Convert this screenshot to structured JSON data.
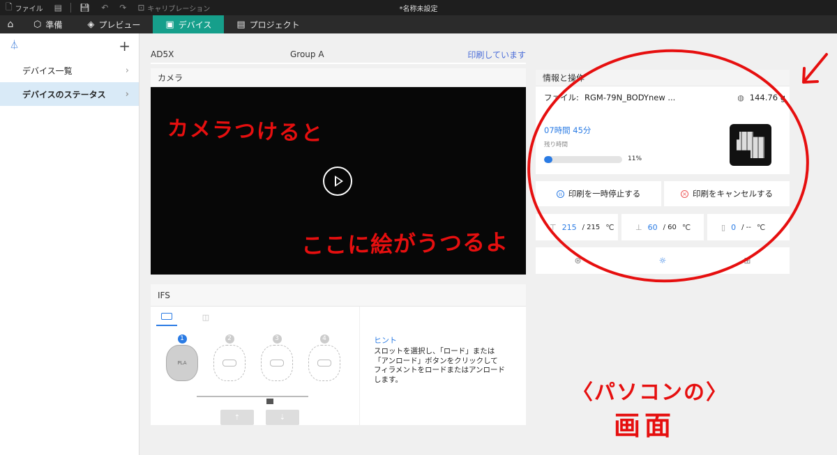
{
  "titlebar": {
    "file_label": "ファイル",
    "calibration_label": "キャリブレーション",
    "doc_title": "*名称未設定"
  },
  "nav": {
    "tabs": [
      {
        "label": "準備",
        "icon": "cube-icon"
      },
      {
        "label": "プレビュー",
        "icon": "layers-icon"
      },
      {
        "label": "デバイス",
        "icon": "device-icon",
        "active": true
      },
      {
        "label": "プロジェクト",
        "icon": "project-icon"
      }
    ]
  },
  "sidebar": {
    "items": [
      {
        "label": "デバイス一覧"
      },
      {
        "label": "デバイスのステータス",
        "active": true
      }
    ]
  },
  "device": {
    "name": "AD5X",
    "group": "Group A",
    "status": "印刷しています"
  },
  "camera": {
    "title": "カメラ"
  },
  "ifs": {
    "title": "IFS",
    "slots": [
      {
        "num": "1",
        "material": "PLA",
        "active": true
      },
      {
        "num": "2",
        "material": ""
      },
      {
        "num": "3",
        "material": ""
      },
      {
        "num": "4",
        "material": ""
      }
    ],
    "hint_title": "ヒント",
    "hint_text": "スロットを選択し、「ロード」または\n「アンロード」ボタンをクリックして\nフィラメントをロードまたはアンロード\nします。"
  },
  "info": {
    "title": "情報と操作",
    "file_label": "ファイル:",
    "file_name": "RGM-79N_BODYnew ...",
    "weight": "144.76 g",
    "remaining_time": "07時間 45分",
    "remaining_label": "残り時間",
    "progress_percent": 11,
    "progress_label": "11%",
    "pause_label": "印刷を一時停止する",
    "cancel_label": "印刷をキャンセルする"
  },
  "temps": {
    "nozzle": {
      "current": "215",
      "target": "/ 215",
      "unit": "℃"
    },
    "bed": {
      "current": "60",
      "target": "/ 60",
      "unit": "℃"
    },
    "chamber": {
      "current": "0",
      "target": "/ --",
      "unit": "℃"
    }
  },
  "annotations": {
    "camera_line1": "カメラつけると",
    "camera_line2": "ここに絵がうつるよ",
    "pc_line1": "〈パソコンの〉",
    "pc_line2": "画面"
  },
  "colors": {
    "accent": "#169f8b",
    "blue": "#2a7be4",
    "annotation_red": "#e60f0f"
  }
}
